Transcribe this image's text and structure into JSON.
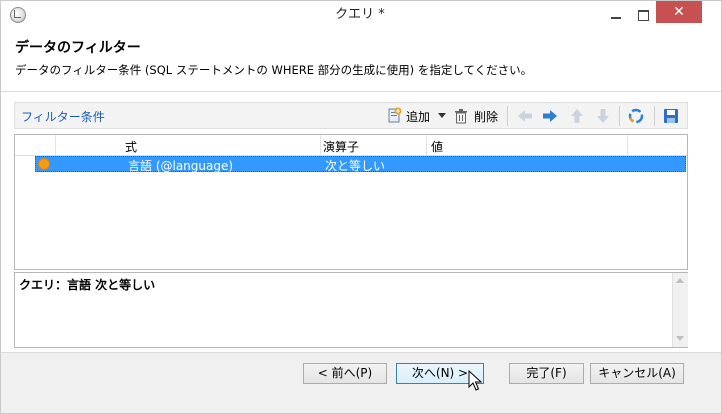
{
  "window": {
    "title": "クエリ *",
    "close_glyph": "✕"
  },
  "header": {
    "title": "データのフィルター",
    "description": "データのフィルター条件 (SQL ステートメントの WHERE 部分の生成に使用) を指定してください。"
  },
  "toolbar": {
    "label": "フィルター条件",
    "add_label": "追加",
    "delete_label": "削除",
    "icons": [
      "add-icon",
      "dropdown-arrow-icon",
      "delete-icon",
      "arrow-left-icon",
      "arrow-right-icon",
      "arrow-up-icon",
      "arrow-down-icon",
      "refresh-icon",
      "save-icon"
    ]
  },
  "grid": {
    "columns": [
      "式",
      "演算子",
      "値"
    ],
    "rows": [
      {
        "expression": "言語 (@language)",
        "operator": "次と等しい",
        "value": ""
      }
    ]
  },
  "summary": {
    "text": "クエリ：言語 次と等しい"
  },
  "buttons": {
    "prev": "< 前へ(P)",
    "next": "次へ(N) >",
    "finish": "完了(F)",
    "cancel": "キャンセル(A)"
  },
  "colors": {
    "selection": "#3399ff",
    "accent_link": "#1b5fb4",
    "close_button": "#c75050",
    "status_dot": "#f39c12"
  }
}
